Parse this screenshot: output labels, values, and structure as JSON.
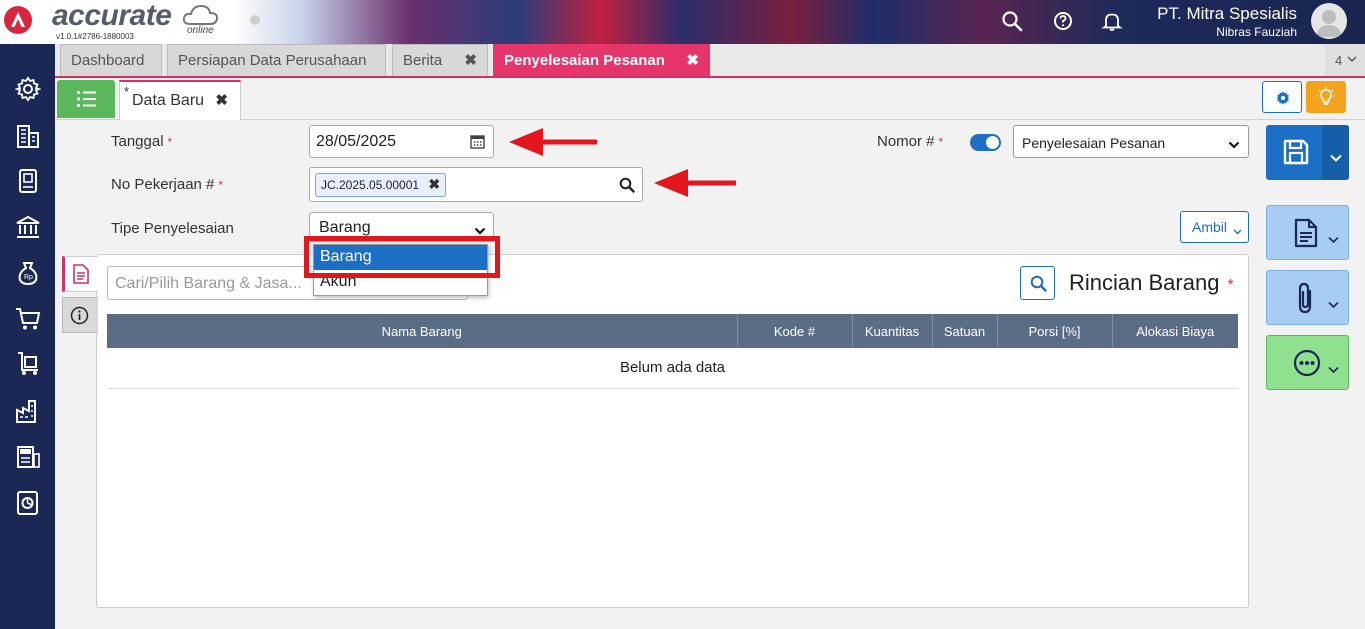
{
  "header": {
    "logo_text": "accurate",
    "logo_sub": "online",
    "version": "v1.0.1#2786-1880003",
    "company_name": "PT. Mitra Spesialis",
    "user_name": "Nibras Fauziah"
  },
  "tabs": [
    {
      "label": "Dashboard",
      "closable": false
    },
    {
      "label": "Persiapan Data Perusahaan",
      "closable": false
    },
    {
      "label": "Berita",
      "closable": true
    },
    {
      "label": "Penyelesaian Pesanan",
      "closable": true,
      "active": true
    }
  ],
  "tab_count": "4",
  "subtab": {
    "modified_mark": "*",
    "label": "Data Baru"
  },
  "form": {
    "tanggal_label": "Tanggal",
    "tanggal_value": "28/05/2025",
    "no_pekerjaan_label": "No Pekerjaan #",
    "no_pekerjaan_chip": "JC.2025.05.00001",
    "tipe_label": "Tipe Penyelesaian",
    "tipe_value": "Barang",
    "nomor_label": "Nomor #",
    "nomor_select": "Penyelesaian Pesanan",
    "required_mark": "*",
    "ambil_label": "Ambil"
  },
  "dropdown": {
    "options": [
      "Barang",
      "Akun"
    ],
    "selected": "Barang"
  },
  "detail": {
    "search_placeholder": "Cari/Pilih Barang & Jasa...",
    "title": "Rincian Barang",
    "columns": [
      "Nama Barang",
      "Kode #",
      "Kuantitas",
      "Satuan",
      "Porsi [%]",
      "Alokasi Biaya"
    ],
    "empty_text": "Belum ada data"
  },
  "colors": {
    "accent_pink": "#e6356b",
    "primary_blue": "#1b6fc4",
    "sidebar_navy": "#1b2855",
    "highlight_red": "#e3161c"
  },
  "icons": [
    "search-icon",
    "help-icon",
    "bell-icon",
    "gear-icon",
    "building-icon",
    "book-icon",
    "bank-icon",
    "money-bag-icon",
    "cart-icon",
    "trolley-icon",
    "factory-icon",
    "tax-icon",
    "report-icon",
    "calendar-icon",
    "save-icon",
    "document-icon",
    "paperclip-icon",
    "more-icon",
    "bulb-icon",
    "list-icon",
    "info-icon"
  ]
}
